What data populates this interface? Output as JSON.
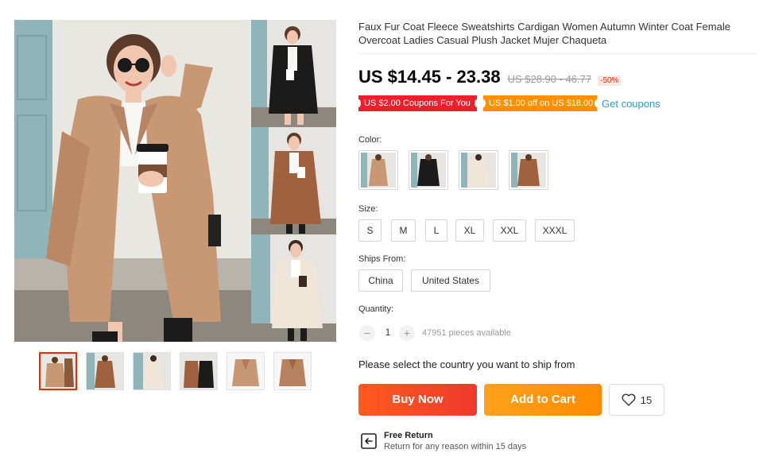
{
  "product": {
    "title": "Faux Fur Coat Fleece Sweatshirts Cardigan Women Autumn Winter Coat Female Overcoat Ladies Casual Plush Jacket Mujer Chaqueta",
    "price": "US $14.45 - 23.38",
    "original_price": "US $28.90 - 46.77",
    "discount": "-50%"
  },
  "coupons": {
    "items": [
      "US $2.00 Coupons For You",
      "US $1.00 off on US $18.00"
    ],
    "get_label": "Get coupons"
  },
  "color": {
    "label": "Color:",
    "swatches": [
      "camel-coat",
      "black-coat",
      "cream-coat",
      "brown-coat"
    ]
  },
  "size": {
    "label": "Size:",
    "options": [
      "S",
      "M",
      "L",
      "XL",
      "XXL",
      "XXXL"
    ]
  },
  "ships_from": {
    "label": "Ships From:",
    "options": [
      "China",
      "United States"
    ]
  },
  "quantity": {
    "label": "Quantity:",
    "minus": "−",
    "plus": "+",
    "value": "1",
    "available": "47951 pieces available"
  },
  "shipping_message": "Please select the country you want to ship from",
  "actions": {
    "buy_now": "Buy Now",
    "add_to_cart": "Add to Cart",
    "wishlist_count": "15"
  },
  "return_policy": {
    "title": "Free Return",
    "subtitle": "Return for any reason within 15 days"
  },
  "colors": {
    "accent_red": "#e62e04",
    "coupon_red": "#ee1f2c",
    "coupon_orange": "#ff9000",
    "link_blue": "#2e9cc3",
    "camel": "#c89774",
    "brown": "#a0623e",
    "cream": "#efe6d8",
    "black": "#1b1b1b"
  }
}
